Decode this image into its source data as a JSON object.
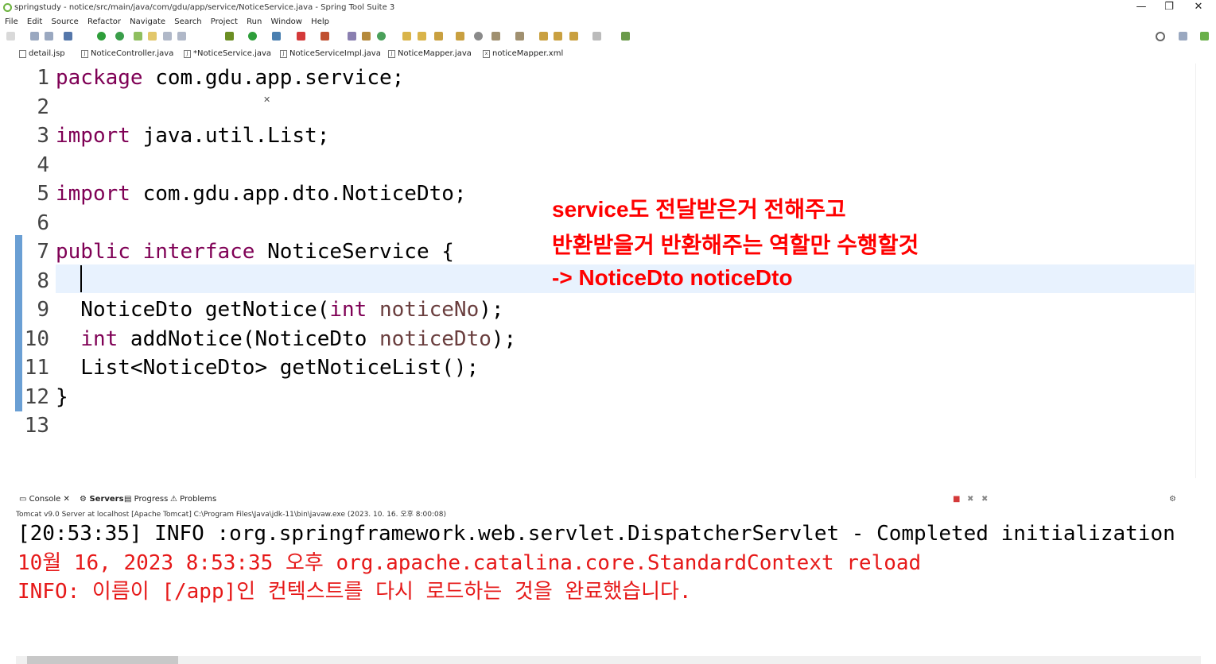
{
  "window": {
    "title": "springstudy - notice/src/main/java/com/gdu/app/service/NoticeService.java - Spring Tool Suite 3",
    "controls": [
      "—",
      "❐",
      "✕"
    ]
  },
  "menu": [
    "File",
    "Edit",
    "Source",
    "Refactor",
    "Navigate",
    "Search",
    "Project",
    "Run",
    "Window",
    "Help"
  ],
  "tabs": [
    {
      "label": "detail.jsp",
      "icon": "jsp-file-icon",
      "active": false
    },
    {
      "label": "NoticeController.java",
      "icon": "java-file-icon",
      "active": false
    },
    {
      "label": "*NoticeService.java",
      "icon": "java-file-icon",
      "active": true
    },
    {
      "label": "NoticeServiceImpl.java",
      "icon": "java-file-icon",
      "active": false
    },
    {
      "label": "NoticeMapper.java",
      "icon": "java-file-icon",
      "active": false
    },
    {
      "label": "noticeMapper.xml",
      "icon": "xml-file-icon",
      "active": false
    }
  ],
  "tab_close": "✕",
  "editor": {
    "line_numbers": [
      "1",
      "2",
      "3",
      "4",
      "5",
      "6",
      "7",
      "8",
      "9",
      "10",
      "11",
      "12",
      "13"
    ],
    "lines": [
      [
        {
          "t": "package",
          "c": "kw"
        },
        {
          "t": " com.gdu.app.service;",
          "c": ""
        }
      ],
      [],
      [
        {
          "t": "import",
          "c": "kw"
        },
        {
          "t": " java.util.List;",
          "c": ""
        }
      ],
      [],
      [
        {
          "t": "import",
          "c": "kw"
        },
        {
          "t": " com.gdu.app.dto.NoticeDto;",
          "c": ""
        }
      ],
      [],
      [
        {
          "t": "public",
          "c": "kw"
        },
        {
          "t": " ",
          "c": ""
        },
        {
          "t": "interface",
          "c": "kw"
        },
        {
          "t": " NoticeService {",
          "c": ""
        }
      ],
      [],
      [
        {
          "t": "  NoticeDto getNotice(",
          "c": ""
        },
        {
          "t": "int",
          "c": "kw"
        },
        {
          "t": " ",
          "c": ""
        },
        {
          "t": "noticeNo",
          "c": "var"
        },
        {
          "t": ");",
          "c": ""
        }
      ],
      [
        {
          "t": "  ",
          "c": ""
        },
        {
          "t": "int",
          "c": "kw"
        },
        {
          "t": " addNotice(NoticeDto ",
          "c": ""
        },
        {
          "t": "noticeDto",
          "c": "var"
        },
        {
          "t": ");",
          "c": ""
        }
      ],
      [
        {
          "t": "  List<NoticeDto> getNoticeList();",
          "c": ""
        }
      ],
      [
        {
          "t": "}",
          "c": ""
        }
      ],
      []
    ]
  },
  "annotation": {
    "line1": "service도 전달받은거 전해주고",
    "line2": "반환받을거 반환해주는 역할만 수행할것",
    "line3": "-> NoticeDto noticeDto"
  },
  "console_tabs": [
    "Console",
    "Servers",
    "Progress",
    "Problems"
  ],
  "console_info": "Tomcat v9.0 Server at localhost [Apache Tomcat] C:\\Program Files\\Java\\jdk-11\\bin\\javaw.exe  (2023. 10. 16. 오후 8:00:08)",
  "console_lines": [
    {
      "text": "[20:53:35] INFO :org.springframework.web.servlet.DispatcherServlet - Completed initialization",
      "kind": "normal"
    },
    {
      "text": "10월 16, 2023 8:53:35 오후 org.apache.catalina.core.StandardContext reload",
      "kind": "err"
    },
    {
      "text": "INFO: 이름이 [/app]인 컨텍스트를 다시 로드하는 것을 완료했습니다.",
      "kind": "err"
    }
  ]
}
